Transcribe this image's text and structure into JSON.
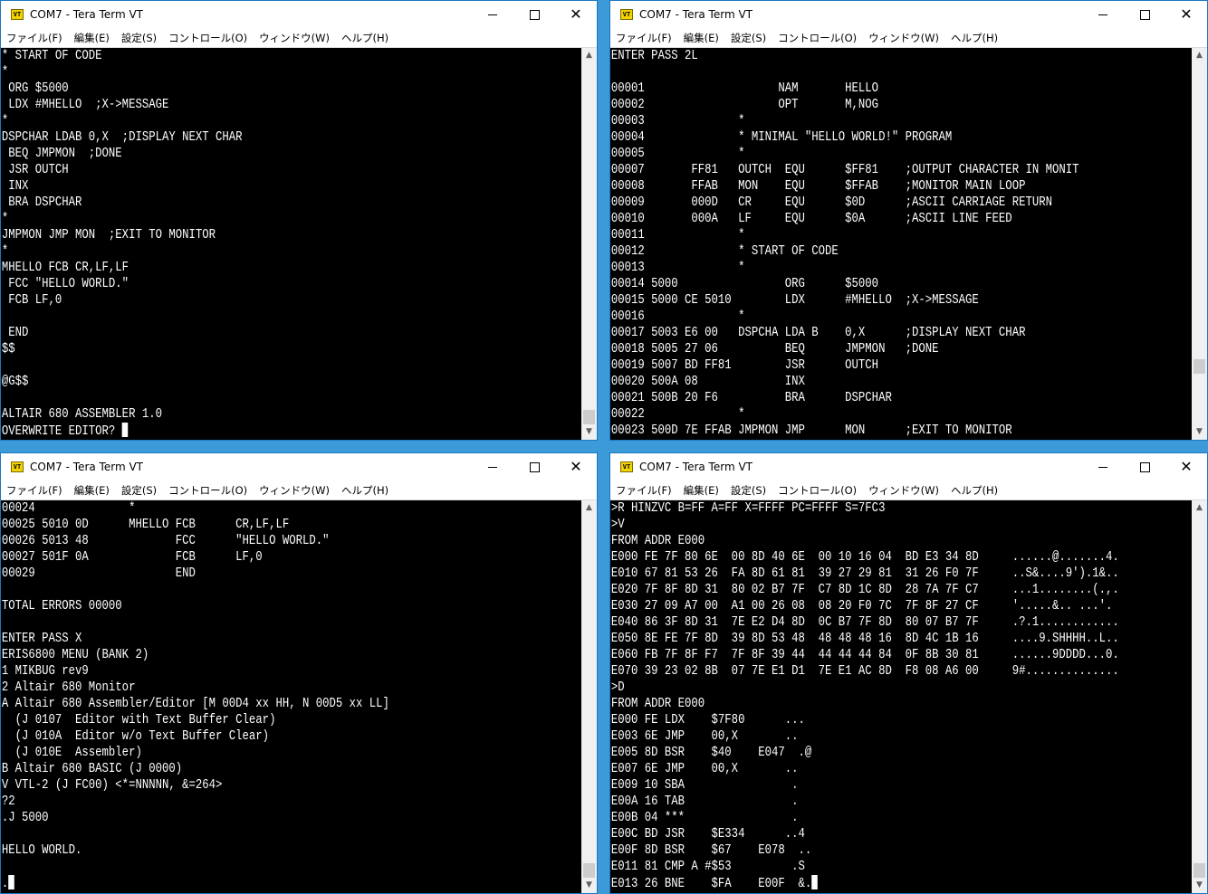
{
  "windows": [
    {
      "title": "COM7 - Tera Term VT",
      "icon_label": "VT",
      "menu": [
        "ファイル(F)",
        "編集(E)",
        "設定(S)",
        "コントロール(O)",
        "ウィンドウ(W)",
        "ヘルプ(H)"
      ],
      "lines": [
        "* START OF CODE",
        "*",
        " ORG $5000",
        " LDX #MHELLO  ;X->MESSAGE",
        "*",
        "DSPCHAR LDAB 0,X  ;DISPLAY NEXT CHAR",
        " BEQ JMPMON  ;DONE",
        " JSR OUTCH",
        " INX",
        " BRA DSPCHAR",
        "*",
        "JMPMON JMP MON  ;EXIT TO MONITOR",
        "*",
        "MHELLO FCB CR,LF,LF",
        " FCC \"HELLO WORLD.\"",
        " FCB LF,0",
        "",
        " END",
        "$$",
        "",
        "@G$$",
        "",
        "ALTAIR 680 ASSEMBLER 1.0",
        "OVERWRITE EDITOR? "
      ]
    },
    {
      "title": "COM7 - Tera Term VT",
      "icon_label": "VT",
      "menu": [
        "ファイル(F)",
        "編集(E)",
        "設定(S)",
        "コントロール(O)",
        "ウィンドウ(W)",
        "ヘルプ(H)"
      ],
      "lines": [
        "ENTER PASS 2L",
        "",
        "00001                    NAM       HELLO",
        "00002                    OPT       M,NOG",
        "00003              *",
        "00004              * MINIMAL \"HELLO WORLD!\" PROGRAM",
        "00005              *",
        "00007       FF81   OUTCH  EQU      $FF81    ;OUTPUT CHARACTER IN MONIT",
        "00008       FFAB   MON    EQU      $FFAB    ;MONITOR MAIN LOOP",
        "00009       000D   CR     EQU      $0D      ;ASCII CARRIAGE RETURN",
        "00010       000A   LF     EQU      $0A      ;ASCII LINE FEED",
        "00011              *",
        "00012              * START OF CODE",
        "00013              *",
        "00014 5000                ORG      $5000",
        "00015 5000 CE 5010        LDX      #MHELLO  ;X->MESSAGE",
        "00016              *",
        "00017 5003 E6 00   DSPCHA LDA B    0,X      ;DISPLAY NEXT CHAR",
        "00018 5005 27 06          BEQ      JMPMON   ;DONE",
        "00019 5007 BD FF81        JSR      OUTCH",
        "00020 500A 08             INX",
        "00021 500B 20 F6          BRA      DSPCHAR",
        "00022              *",
        "00023 500D 7E FFAB JMPMON JMP      MON      ;EXIT TO MONITOR"
      ]
    },
    {
      "title": "COM7 - Tera Term VT",
      "icon_label": "VT",
      "menu": [
        "ファイル(F)",
        "編集(E)",
        "設定(S)",
        "コントロール(O)",
        "ウィンドウ(W)",
        "ヘルプ(H)"
      ],
      "lines": [
        "00024              *",
        "00025 5010 0D      MHELLO FCB      CR,LF,LF",
        "00026 5013 48             FCC      \"HELLO WORLD.\"",
        "00027 501F 0A             FCB      LF,0",
        "00029                     END",
        "",
        "TOTAL ERRORS 00000",
        "",
        "ENTER PASS X",
        "ERIS6800 MENU (BANK 2)",
        "1 MIKBUG rev9",
        "2 Altair 680 Monitor",
        "A Altair 680 Assembler/Editor [M 00D4 xx HH, N 00D5 xx LL]",
        "  (J 0107  Editor with Text Buffer Clear)",
        "  (J 010A  Editor w/o Text Buffer Clear)",
        "  (J 010E  Assembler)",
        "B Altair 680 BASIC (J 0000)",
        "V VTL-2 (J FC00) <*=NNNNN, &=264>",
        "?2",
        ".J 5000",
        "",
        "HELLO WORLD.",
        "",
        "."
      ]
    },
    {
      "title": "COM7 - Tera Term VT",
      "icon_label": "VT",
      "menu": [
        "ファイル(F)",
        "編集(E)",
        "設定(S)",
        "コントロール(O)",
        "ウィンドウ(W)",
        "ヘルプ(H)"
      ],
      "lines": [
        ">R HINZVC B=FF A=FF X=FFFF PC=FFFF S=7FC3",
        ">V",
        "FROM ADDR E000",
        "E000 FE 7F 80 6E  00 8D 40 6E  00 10 16 04  BD E3 34 8D     ......@.......4.",
        "E010 67 81 53 26  FA 8D 61 81  39 27 29 81  31 26 F0 7F     ..S&....9').1&..",
        "E020 7F 8F 8D 31  80 02 B7 7F  C7 8D 1C 8D  28 7A 7F C7     ...1........(.,.",
        "E030 27 09 A7 00  A1 00 26 08  08 20 F0 7C  7F 8F 27 CF     '.....&.. ...'.",
        "E040 86 3F 8D 31  7E E2 D4 8D  0C B7 7F 8D  80 07 B7 7F     .?.1............",
        "E050 8E FE 7F 8D  39 8D 53 48  48 48 48 16  8D 4C 1B 16     ....9.SHHHH..L..",
        "E060 FB 7F 8F F7  7F 8F 39 44  44 44 44 84  0F 8B 30 81     ......9DDDD...0.",
        "E070 39 23 02 8B  07 7E E1 D1  7E E1 AC 8D  F8 08 A6 00     9#..............",
        ">D",
        "FROM ADDR E000",
        "E000 FE LDX    $7F80      ...",
        "E003 6E JMP    00,X       ..",
        "E005 8D BSR    $40    E047  .@",
        "E007 6E JMP    00,X       ..",
        "E009 10 SBA                .",
        "E00A 16 TAB                .",
        "E00B 04 ***                .",
        "E00C BD JSR    $E334      ..4",
        "E00F 8D BSR    $67    E078  ..",
        "E011 81 CMP A #$53         .S",
        "E013 26 BNE    $FA    E00F  &."
      ]
    }
  ]
}
